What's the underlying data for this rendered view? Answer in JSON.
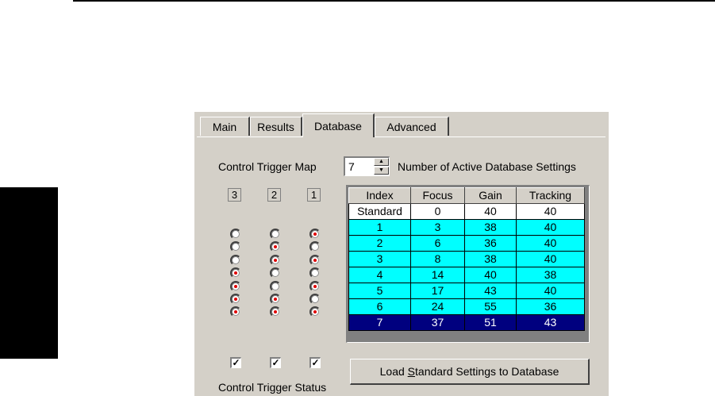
{
  "tabs": [
    {
      "label": "Main"
    },
    {
      "label": "Results"
    },
    {
      "label": "Database",
      "active": true
    },
    {
      "label": "Advanced"
    }
  ],
  "database": {
    "control_trigger_map_label": "Control Trigger Map",
    "active_settings_value": "7",
    "active_settings_label": "Number of Active Database Settings",
    "bit_labels": [
      "3",
      "2",
      "1"
    ],
    "radio_rows": [
      [
        false,
        false,
        true
      ],
      [
        false,
        true,
        false
      ],
      [
        false,
        true,
        true
      ],
      [
        true,
        false,
        false
      ],
      [
        true,
        false,
        true
      ],
      [
        true,
        true,
        false
      ],
      [
        true,
        true,
        true
      ]
    ],
    "status_checked": [
      true,
      true,
      true
    ],
    "control_trigger_status_label": "Control Trigger Status",
    "table": {
      "columns": [
        "Index",
        "Focus",
        "Gain",
        "Tracking"
      ],
      "rows": [
        [
          "Standard",
          "0",
          "40",
          "40"
        ],
        [
          "1",
          "3",
          "38",
          "40"
        ],
        [
          "2",
          "6",
          "36",
          "40"
        ],
        [
          "3",
          "8",
          "38",
          "40"
        ],
        [
          "4",
          "14",
          "40",
          "38"
        ],
        [
          "5",
          "17",
          "43",
          "40"
        ],
        [
          "6",
          "24",
          "55",
          "36"
        ],
        [
          "7",
          "37",
          "51",
          "43"
        ]
      ],
      "selected_row": 7
    },
    "load_button": {
      "pre": "Load ",
      "accel": "S",
      "post": "tandard Settings to Database"
    }
  },
  "colors": {
    "row_cyan": "#00ffff",
    "row_selected": "#00007f",
    "radio_dot": "#e00000",
    "dialog_bg": "#d4d0c8"
  }
}
